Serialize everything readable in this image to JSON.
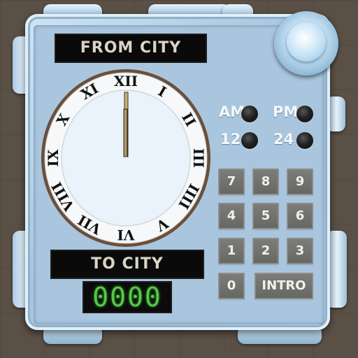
{
  "labels": {
    "from_city": "FROM CITY",
    "to_city": "TO CITY",
    "display_value": "0000"
  },
  "clock": {
    "numerals": [
      "XII",
      "I",
      "II",
      "III",
      "IIII",
      "V",
      "VI",
      "VII",
      "VIII",
      "IX",
      "X",
      "XI"
    ],
    "time_shown": "12:00"
  },
  "indicators": [
    {
      "label": "AM",
      "lit": false
    },
    {
      "label": "PM",
      "lit": false
    },
    {
      "label": "12",
      "lit": false
    },
    {
      "label": "24",
      "lit": false
    }
  ],
  "keypad": {
    "keys": [
      "7",
      "8",
      "9",
      "4",
      "5",
      "6",
      "1",
      "2",
      "3",
      "0",
      "INTRO"
    ]
  },
  "colors": {
    "device": "#a9c6de",
    "label_bg": "#0a0a0a",
    "digit_green": "#56c845",
    "key_grey": "#6f6f6c",
    "lamp_off": "#111111"
  }
}
